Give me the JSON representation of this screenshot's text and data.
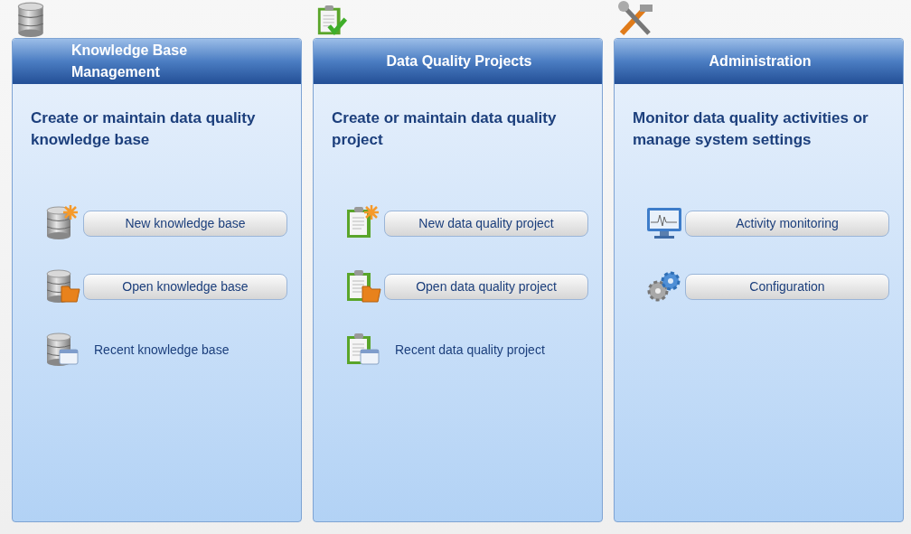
{
  "panels": [
    {
      "title": "Knowledge Base Management",
      "heading": "Create or maintain data quality knowledge base",
      "actions": [
        {
          "kind": "button",
          "label": "New knowledge base"
        },
        {
          "kind": "button",
          "label": "Open knowledge base"
        },
        {
          "kind": "link",
          "label": "Recent knowledge base"
        }
      ]
    },
    {
      "title": "Data Quality Projects",
      "heading": "Create or maintain data quality project",
      "actions": [
        {
          "kind": "button",
          "label": "New data quality project"
        },
        {
          "kind": "button",
          "label": "Open data quality project"
        },
        {
          "kind": "link",
          "label": "Recent data quality project"
        }
      ]
    },
    {
      "title": "Administration",
      "heading": "Monitor data quality activities or manage system settings",
      "actions": [
        {
          "kind": "button",
          "label": "Activity monitoring"
        },
        {
          "kind": "button",
          "label": "Configuration"
        }
      ]
    }
  ]
}
